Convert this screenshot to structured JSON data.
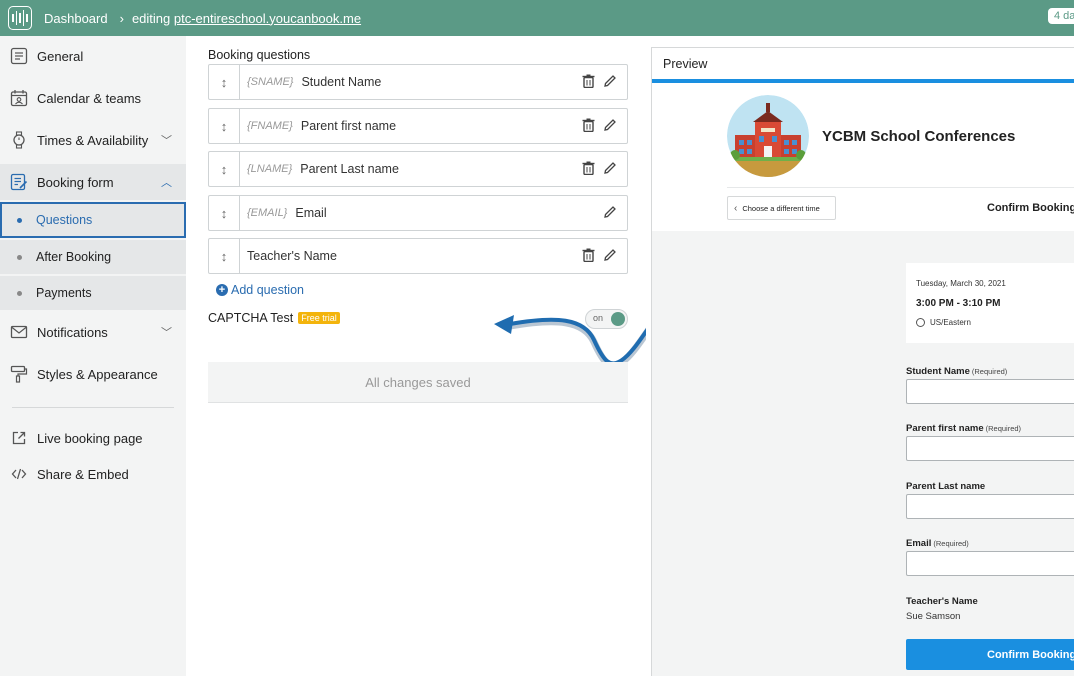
{
  "topbar": {
    "dashboard": "Dashboard",
    "editing_prefix": "editing",
    "editing_link": "ptc-entireschool.youcanbook.me",
    "trial_badge": "4 da"
  },
  "sidebar": {
    "items": [
      {
        "label": "General",
        "icon": "general-icon"
      },
      {
        "label": "Calendar & teams",
        "icon": "calendar-icon"
      },
      {
        "label": "Times & Availability",
        "icon": "watch-icon"
      },
      {
        "label": "Booking form",
        "icon": "form-icon"
      },
      {
        "label": "Notifications",
        "icon": "mail-icon"
      },
      {
        "label": "Styles & Appearance",
        "icon": "paint-roller-icon"
      },
      {
        "label": "Live booking page",
        "icon": "external-link-icon"
      },
      {
        "label": "Share & Embed",
        "icon": "code-icon"
      }
    ],
    "subitems": [
      {
        "label": "Questions",
        "selected": true
      },
      {
        "label": "After Booking",
        "selected": false
      },
      {
        "label": "Payments",
        "selected": false
      }
    ]
  },
  "main": {
    "section_title": "Booking questions",
    "questions": [
      {
        "tag": "{SNAME}",
        "label": "Student Name"
      },
      {
        "tag": "{FNAME}",
        "label": "Parent first name"
      },
      {
        "tag": "{LNAME}",
        "label": "Parent Last name"
      },
      {
        "tag": "{EMAIL}",
        "label": "Email"
      },
      {
        "tag": "",
        "label": "Teacher's Name"
      }
    ],
    "add_question": "Add question",
    "captcha_label": "CAPTCHA Test",
    "captcha_badge": "Free trial",
    "toggle_label": "on",
    "saved_text": "All changes saved"
  },
  "preview": {
    "title": "Preview",
    "school_name": "YCBM School Conferences",
    "back_label": "Choose a different time",
    "confirm_heading": "Confirm Booking",
    "date": "Tuesday, March 30, 2021",
    "time": "3:00 PM - 3:10 PM",
    "timezone": "US/Eastern",
    "fields": [
      {
        "label": "Student Name",
        "req": "(Required)"
      },
      {
        "label": "Parent first name",
        "req": "(Required)"
      },
      {
        "label": "Parent Last name",
        "req": ""
      },
      {
        "label": "Email",
        "req": "(Required)"
      }
    ],
    "teacher_label": "Teacher's Name",
    "teacher_value": "Sue Samson",
    "confirm_button": "Confirm Booking"
  },
  "colors": {
    "topbar": "#5b9a86",
    "accent": "#2a6cb0",
    "preview_accent": "#1a8fe0",
    "badge": "#f3b40c"
  }
}
